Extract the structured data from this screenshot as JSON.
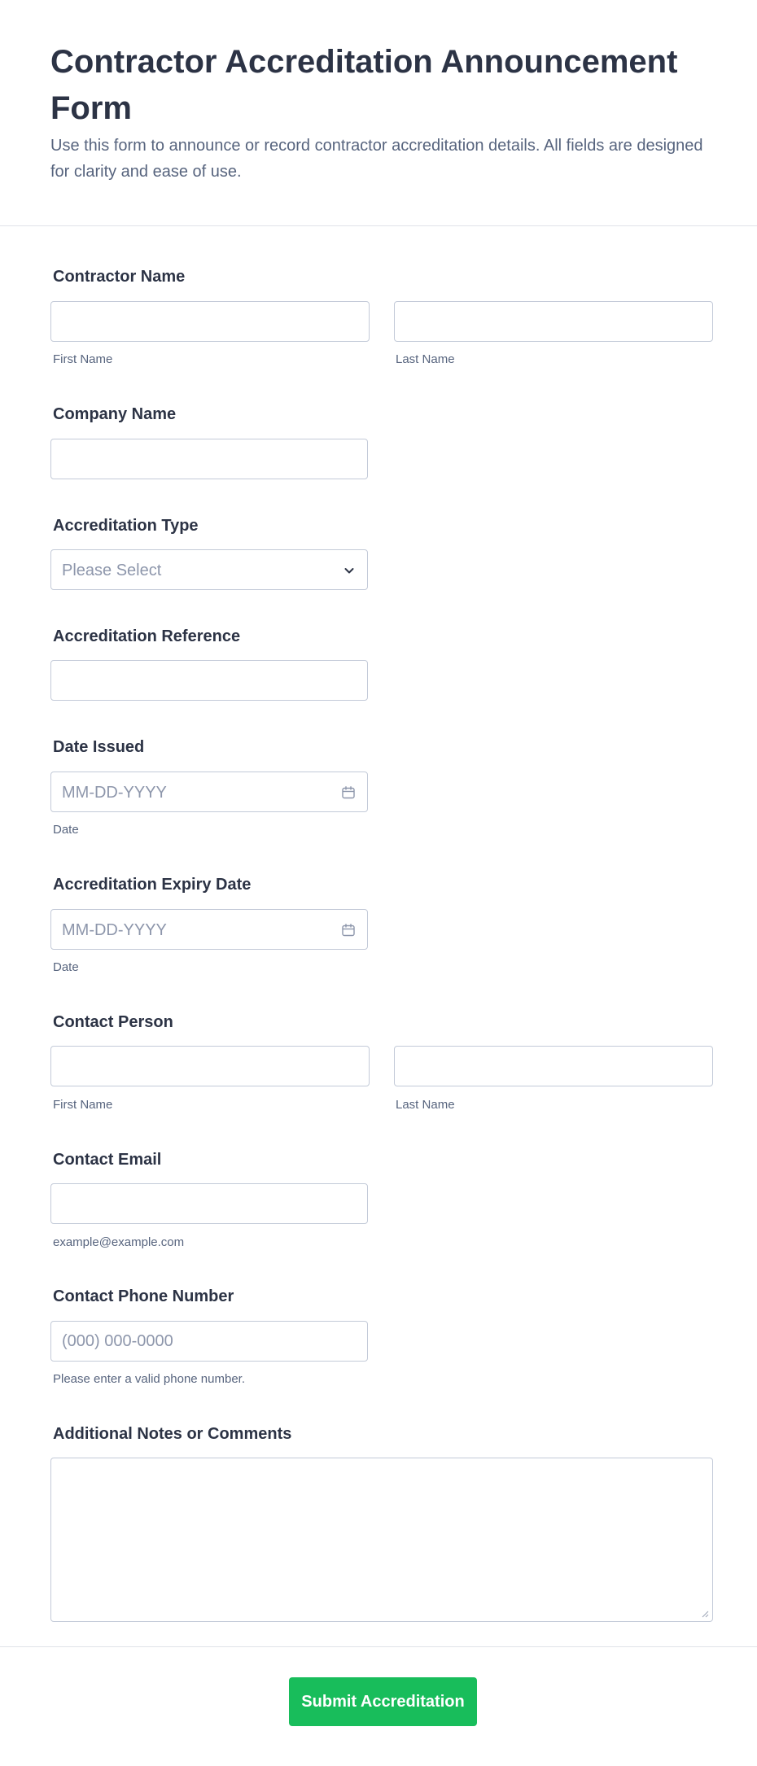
{
  "header": {
    "title": "Contractor Accreditation Announcement Form",
    "subtitle": "Use this form to announce or record contractor accreditation details. All fields are designed for clarity and ease of use."
  },
  "fields": {
    "contractor_name": {
      "label": "Contractor Name",
      "first_sublabel": "First Name",
      "last_sublabel": "Last Name",
      "first_value": "",
      "last_value": ""
    },
    "company_name": {
      "label": "Company Name",
      "value": ""
    },
    "accreditation_type": {
      "label": "Accreditation Type",
      "selected": "Please Select"
    },
    "accreditation_reference": {
      "label": "Accreditation Reference",
      "value": ""
    },
    "date_issued": {
      "label": "Date Issued",
      "placeholder": "MM-DD-YYYY",
      "sublabel": "Date"
    },
    "expiry_date": {
      "label": "Accreditation Expiry Date",
      "placeholder": "MM-DD-YYYY",
      "sublabel": "Date"
    },
    "contact_person": {
      "label": "Contact Person",
      "first_sublabel": "First Name",
      "last_sublabel": "Last Name"
    },
    "contact_email": {
      "label": "Contact Email",
      "sublabel": "example@example.com"
    },
    "contact_phone": {
      "label": "Contact Phone Number",
      "placeholder": "(000) 000-0000",
      "sublabel": "Please enter a valid phone number."
    },
    "notes": {
      "label": "Additional Notes or Comments",
      "value": ""
    }
  },
  "submit": {
    "label": "Submit Accreditation"
  },
  "icons": {
    "select": "chevron-down-icon",
    "date": "calendar-icon",
    "textarea": "resize-grip-icon"
  },
  "colors": {
    "accent": "#18bd5b",
    "text": "#2c3345",
    "muted": "#57647e",
    "border": "#c3cad8"
  }
}
